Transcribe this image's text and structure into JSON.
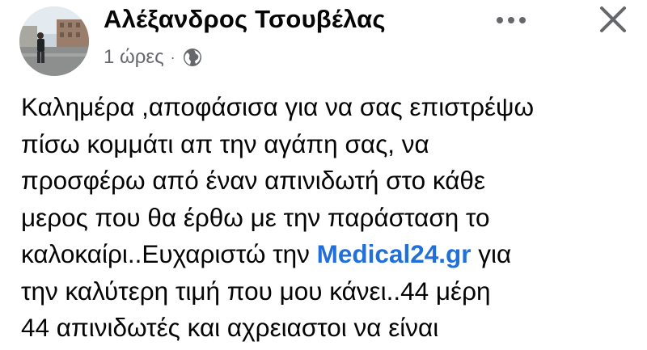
{
  "post": {
    "author_name": "Αλέξανδρος Τσουβέλας",
    "timestamp": "1 ώρες",
    "separator": "·",
    "privacy_icon": "globe-icon",
    "more_icon": "more-horizontal-icon",
    "close_icon": "close-icon",
    "body": {
      "line1": "Καλημέρα ,αποφάσισα για να σας επιστρέψω",
      "line2": "πίσω κομμάτι απ την αγάπη σας, να",
      "line3": "προσφέρω από έναν απινιδωτή στο κάθε",
      "line4": "μερος που θα έρθω με την παράσταση το",
      "line5_before": "καλοκαίρι..Ευχαριστώ την ",
      "line5_link": "Medical24.gr",
      "line5_after": " για",
      "line6": "την καλύτερη τιμή που μου κάνει..44 μέρη",
      "line7": "44 απινιδωτές και αχρειαστοι να είναι"
    }
  },
  "colors": {
    "text": "#050505",
    "meta": "#65676b",
    "link": "#216fdb",
    "background": "#ffffff"
  }
}
